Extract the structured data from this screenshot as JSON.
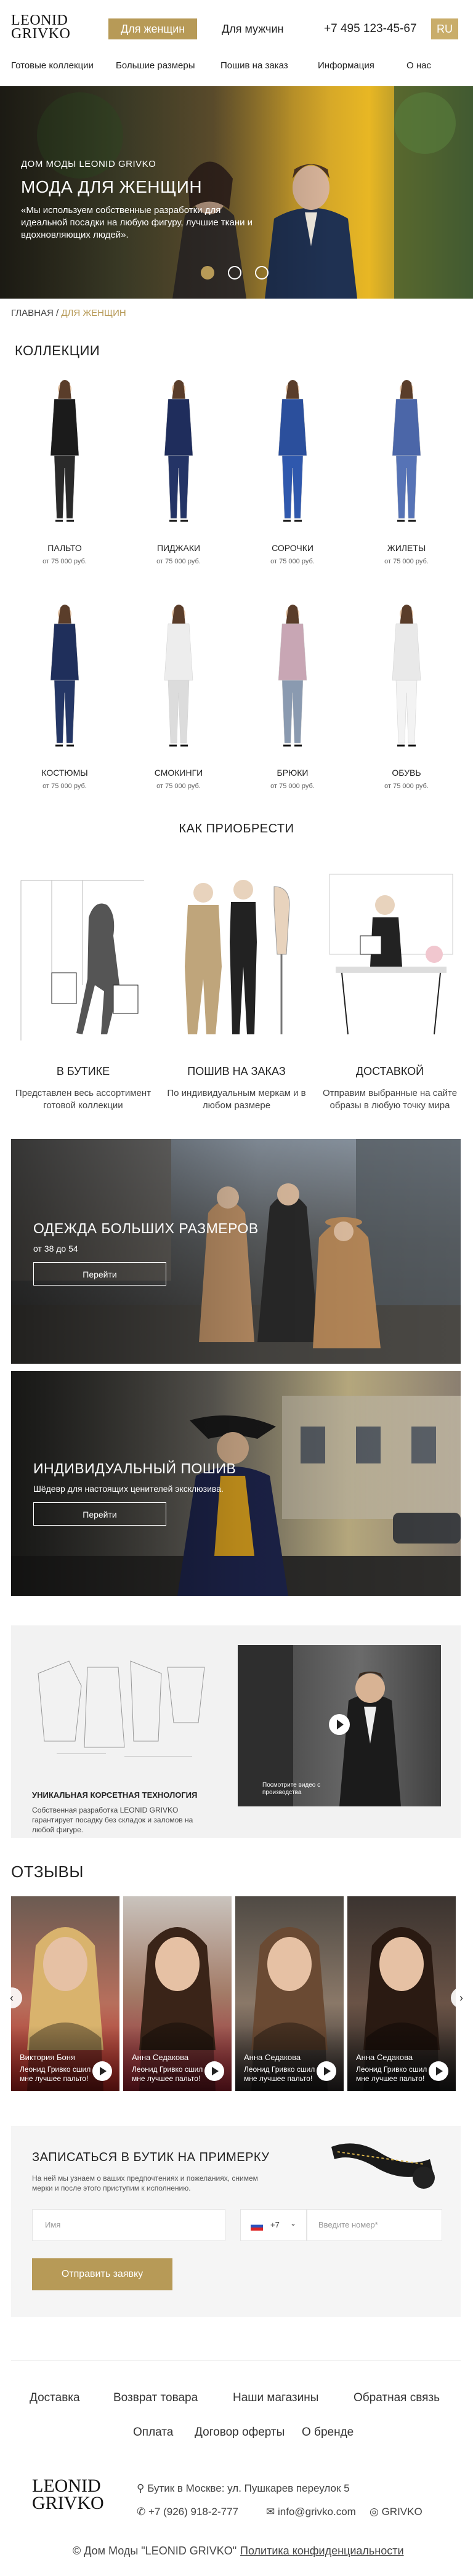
{
  "header": {
    "logo_line1": "LEONID",
    "logo_line2": "GRIVKO",
    "women_label": "Для женщин",
    "men_label": "Для мужчин",
    "phone": "+7 495 123-45-67",
    "lang": "RU"
  },
  "nav": {
    "items": [
      "Готовые коллекции",
      "Большие размеры",
      "Пошив на заказ",
      "Информация",
      "О нас"
    ]
  },
  "hero": {
    "eyebrow": "ДОМ МОДЫ LEONID GRIVKO",
    "title": "МОДА ДЛЯ ЖЕНЩИН",
    "quote": "«Мы используем собственные разработки для идеальной посадки на любую фигуру, лучшие ткани и вдохновляющих людей»."
  },
  "breadcrumb": {
    "home": "ГЛАВНАЯ",
    "sep": "/",
    "current": "ДЛЯ ЖЕНЩИН"
  },
  "collections": {
    "title": "КОЛЛЕКЦИИ",
    "items": [
      {
        "name": "ПАЛЬТО",
        "price": "от 75 000 руб."
      },
      {
        "name": "ПИДЖАКИ",
        "price": "от 75 000 руб."
      },
      {
        "name": "СОРОЧКИ",
        "price": "от 75 000 руб."
      },
      {
        "name": "ЖИЛЕТЫ",
        "price": "от 75 000 руб."
      },
      {
        "name": "КОСТЮМЫ",
        "price": "от 75 000 руб."
      },
      {
        "name": "СМОКИНГИ",
        "price": "от 75 000 руб."
      },
      {
        "name": "БРЮКИ",
        "price": "от 75 000 руб."
      },
      {
        "name": "ОБУВЬ",
        "price": "от 75 000 руб."
      }
    ]
  },
  "how_to_buy": {
    "title": "КАК ПРИОБРЕСТИ",
    "items": [
      {
        "title": "В БУТИКЕ",
        "text": "Представлен весь ассортимент готовой коллекции"
      },
      {
        "title": "ПОШИВ НА ЗАКАЗ",
        "text": "По индивидуальным меркам и в любом размере"
      },
      {
        "title": "ДОСТАВКОЙ",
        "text": "Отправим выбранные на сайте образы в любую точку мира"
      }
    ]
  },
  "plus_size": {
    "title": "ОДЕЖДА БОЛЬШИХ РАЗМЕРОВ",
    "subtitle": "от 38 до 54",
    "button": "Перейти"
  },
  "tailoring": {
    "title": "ИНДИВИДУАЛЬНЫЙ ПОШИВ",
    "subtitle": "Шёдевр для настоящих ценителей эксклюзива.",
    "button": "Перейти"
  },
  "technology": {
    "title": "УНИКАЛЬНАЯ КОРСЕТНАЯ ТЕХНОЛОГИЯ",
    "text": "Собственная разработка LEONID GRIVKO гарантирует посадку без складок и заломов на любой фигуре.",
    "video_caption": "Посмотрите видео с производства"
  },
  "reviews": {
    "title": "ОТЗЫВЫ",
    "items": [
      {
        "name": "Виктория Боня",
        "quote": "Леонид Гривко сшил мне лучшее пальто!"
      },
      {
        "name": "Анна Седакова",
        "quote": "Леонид Гривко сшил мне лучшее пальто!"
      },
      {
        "name": "Анна Седакова",
        "quote": "Леонид Гривко сшил мне лучшее пальто!"
      },
      {
        "name": "Анна Седакова",
        "quote": "Леонид Гривко сшил мне лучшее пальто!"
      }
    ]
  },
  "signup": {
    "title": "ЗАПИСАТЬСЯ В БУТИК НА ПРИМЕРКУ",
    "text": "На ней мы узнаем о ваших предпочтениях и пожеланиях, снимем мерки и после этого приступим к исполнению.",
    "name_placeholder": "Имя",
    "country_code": "+7",
    "phone_placeholder": "Введите номер*",
    "submit": "Отправить заявку"
  },
  "footer": {
    "links_row1": [
      "Доставка",
      "Возврат товара",
      "Наши магазины",
      "Обратная связь"
    ],
    "links_row2": [
      "Оплата",
      "Договор оферты",
      "О бренде"
    ],
    "address": "Бутик в Москве: ул. Пушкарев переулок 5",
    "phone": "+7 (926) 918-2-777",
    "email": "info@grivko.com",
    "social": "GRIVKO",
    "copyright": "© Дом Моды \"LEONID GRIVKO\"",
    "privacy": "Политика конфиденциальности"
  },
  "colors": {
    "accent": "#b79a57",
    "hero_yellow": "#e8b724",
    "dark": "#222222"
  }
}
